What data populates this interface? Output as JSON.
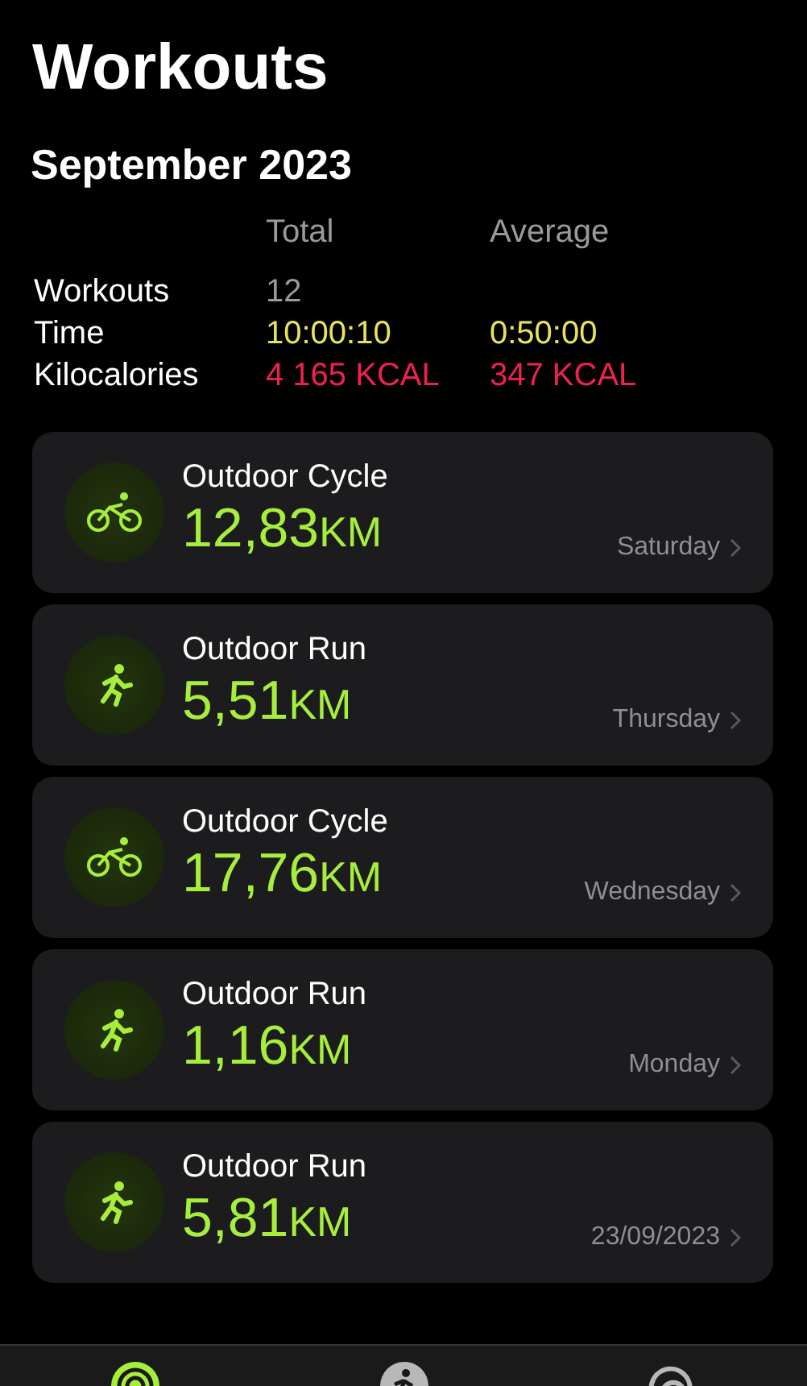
{
  "title": "Workouts",
  "month": "September 2023",
  "summary": {
    "columns": [
      "Total",
      "Average"
    ],
    "rows": [
      {
        "kind": "count",
        "label": "Workouts",
        "total": "12"
      },
      {
        "kind": "time",
        "label": "Time",
        "total": "10:00:10",
        "average": "0:50:00"
      },
      {
        "kind": "energy",
        "label": "Kilocalories",
        "total": "4 165 KCAL",
        "average": "347 KCAL"
      }
    ]
  },
  "workouts": [
    {
      "kind": "cycle",
      "name": "Outdoor Cycle",
      "distance": "12,83",
      "unit": "KM",
      "date": "Saturday"
    },
    {
      "kind": "run",
      "name": "Outdoor Run",
      "distance": "5,51",
      "unit": "KM",
      "date": "Thursday"
    },
    {
      "kind": "cycle",
      "name": "Outdoor Cycle",
      "distance": "17,76",
      "unit": "KM",
      "date": "Wednesday"
    },
    {
      "kind": "run",
      "name": "Outdoor Run",
      "distance": "1,16",
      "unit": "KM",
      "date": "Monday"
    },
    {
      "kind": "run",
      "name": "Outdoor Run",
      "distance": "5,81",
      "unit": "KM",
      "date": "23/09/2023"
    }
  ],
  "tabs": [
    {
      "kind": "rings",
      "selected": true
    },
    {
      "kind": "fitness",
      "selected": false
    },
    {
      "kind": "sharing",
      "selected": false
    }
  ]
}
